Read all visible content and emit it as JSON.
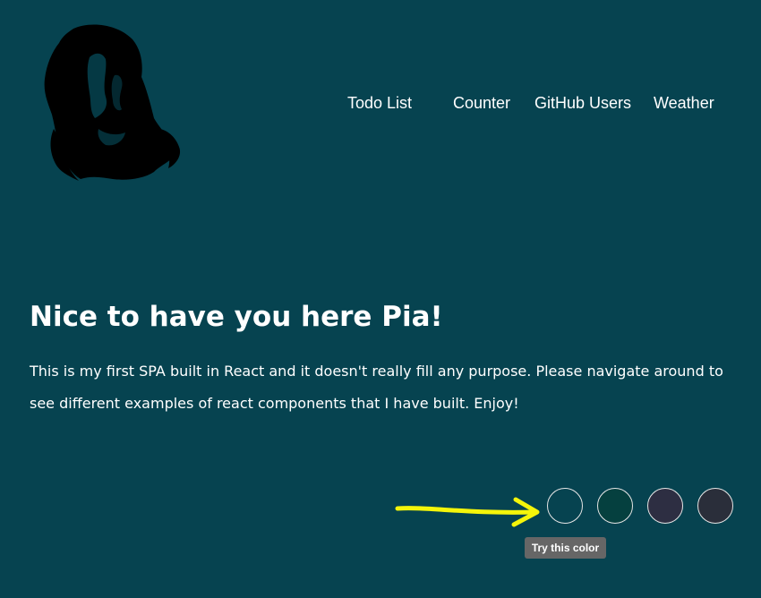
{
  "nav": {
    "items": [
      {
        "label": "Todo List"
      },
      {
        "label": "Counter"
      },
      {
        "label": "GitHub Users"
      },
      {
        "label": "Weather"
      }
    ]
  },
  "hero": {
    "title": "Nice to have you here Pia!",
    "text": "This is my first SPA built in React and it doesn't really fill any purpose. Please navigate around to see different examples of react components that I have built. Enjoy!"
  },
  "colors": {
    "background": "#064350",
    "swatches": [
      "#064350",
      "#05403f",
      "#2d2e42",
      "#2a2e3a"
    ],
    "arrow": "#f5f50a"
  },
  "tooltip": {
    "text": "Try this color"
  }
}
